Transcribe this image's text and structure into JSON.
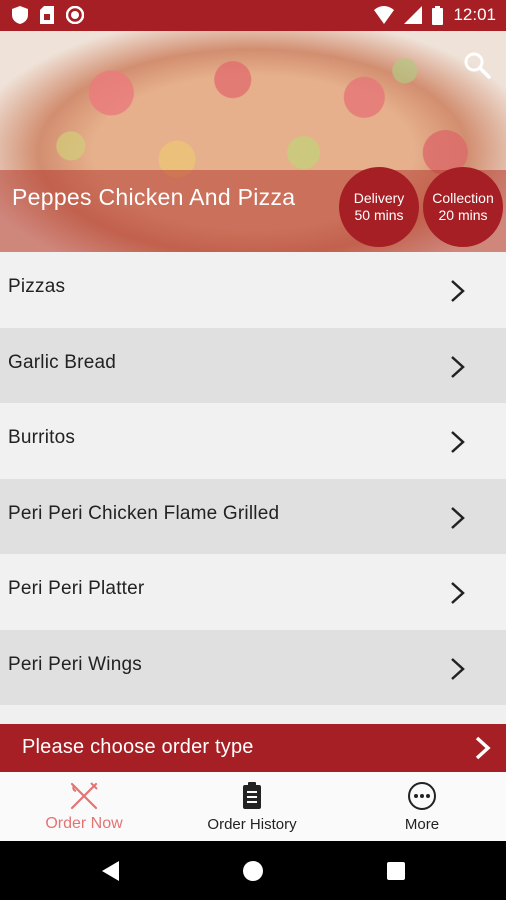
{
  "status_bar": {
    "time": "12:01"
  },
  "hero": {
    "restaurant_name": "Peppes Chicken And Pizza",
    "delivery": {
      "label": "Delivery",
      "time": "50 mins"
    },
    "collection": {
      "label": "Collection",
      "time": "20 mins"
    }
  },
  "menu": {
    "items": [
      {
        "label": "Pizzas"
      },
      {
        "label": "Garlic Bread"
      },
      {
        "label": "Burritos"
      },
      {
        "label": "Peri Peri Chicken Flame Grilled"
      },
      {
        "label": "Peri Peri Platter"
      },
      {
        "label": "Peri Peri Wings"
      }
    ]
  },
  "order_bar": {
    "text": "Please choose order type"
  },
  "bottom_nav": {
    "order_now": "Order Now",
    "order_history": "Order History",
    "more": "More"
  },
  "colors": {
    "brand": "#a61f24",
    "active_nav": "#e47474"
  }
}
